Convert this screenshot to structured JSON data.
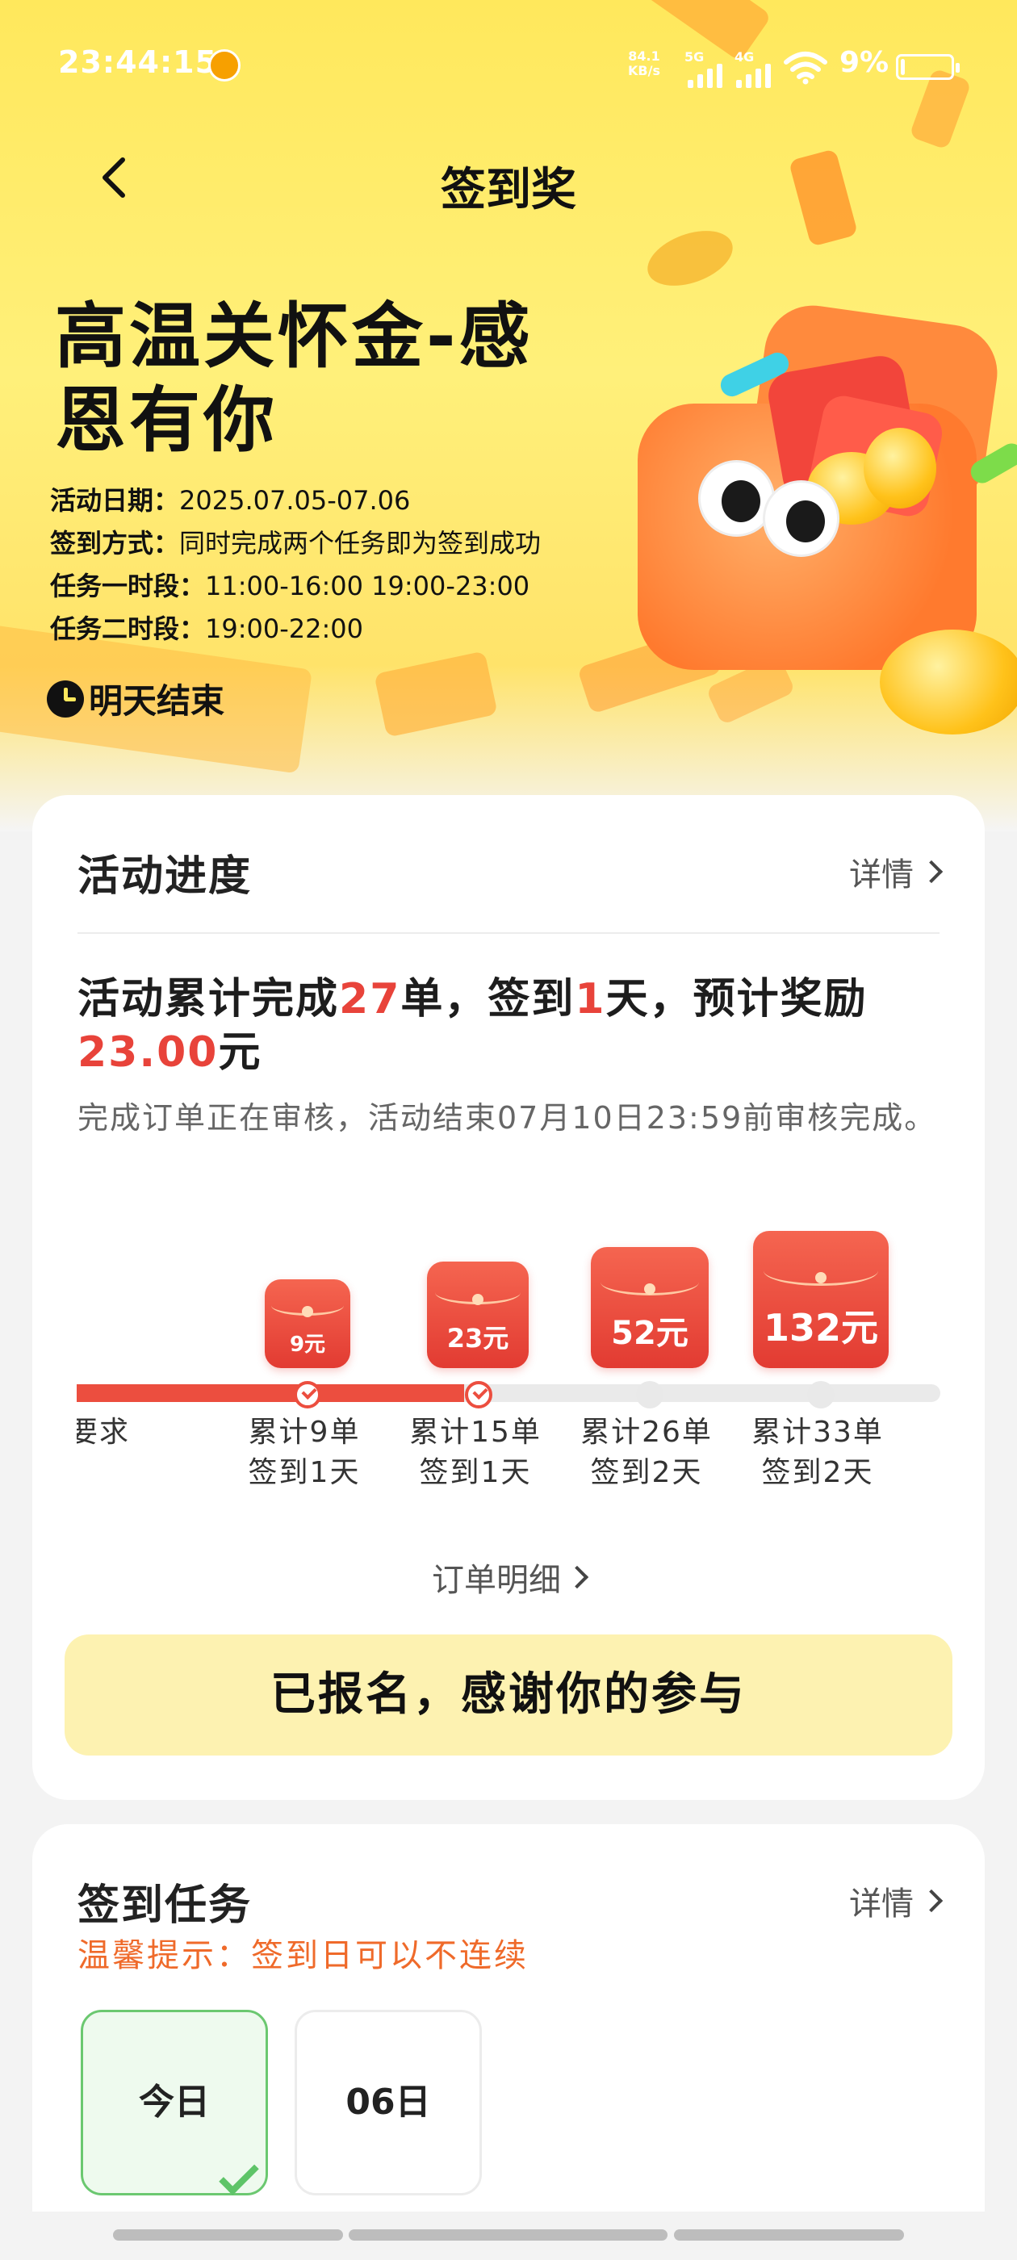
{
  "status_bar": {
    "time": "23:44:15",
    "speed_value": "84.1",
    "speed_unit": "KB/s",
    "signal1": "5G",
    "signal2": "4G",
    "battery_pct": "9%",
    "battery_level": 0.09
  },
  "nav": {
    "title": "签到奖"
  },
  "hero": {
    "title": "高温关怀金-感恩有你",
    "rows": [
      {
        "label": "活动日期：",
        "value": "2025.07.05-07.06"
      },
      {
        "label": "签到方式：",
        "value": "同时完成两个任务即为签到成功"
      },
      {
        "label": "任务一时段：",
        "value": "11:00-16:00 19:00-23:00"
      },
      {
        "label": "任务二时段：",
        "value": "19:00-22:00"
      }
    ],
    "ends_label": "明天结束"
  },
  "progress_card": {
    "title": "活动进度",
    "detail_label": "详情",
    "summary": {
      "p1": "活动累计完成",
      "orders": "27",
      "p2": "单，签到",
      "days": "1",
      "p3": "天，预计奖励",
      "reward": "23.00",
      "p4": "元"
    },
    "note": "完成订单正在审核，活动结束07月10日23:59前审核完成。",
    "milestones": [
      {
        "amount": "",
        "line1": "要求",
        "line2": "",
        "done": true
      },
      {
        "amount": "9元",
        "line1": "累计9单",
        "line2": "签到1天",
        "done": true
      },
      {
        "amount": "23元",
        "line1": "累计15单",
        "line2": "签到1天",
        "done": true
      },
      {
        "amount": "52元",
        "line1": "累计26单",
        "line2": "签到2天",
        "done": false
      },
      {
        "amount": "132元",
        "line1": "累计33单",
        "line2": "签到2天",
        "done": false
      }
    ],
    "orders_link": "订单明细",
    "joined_text": "已报名，感谢你的参与"
  },
  "checkin_card": {
    "title": "签到任务",
    "detail_label": "详情",
    "tip": "温馨提示：签到日可以不连续",
    "days": [
      {
        "label": "今日",
        "active": true
      },
      {
        "label": "06日",
        "active": false
      }
    ]
  },
  "colors": {
    "accent_red": "#e8433a",
    "hero_yellow": "#ffe85c",
    "tip_orange": "#ef6a2a",
    "joined_bg": "#fdf2b1"
  }
}
